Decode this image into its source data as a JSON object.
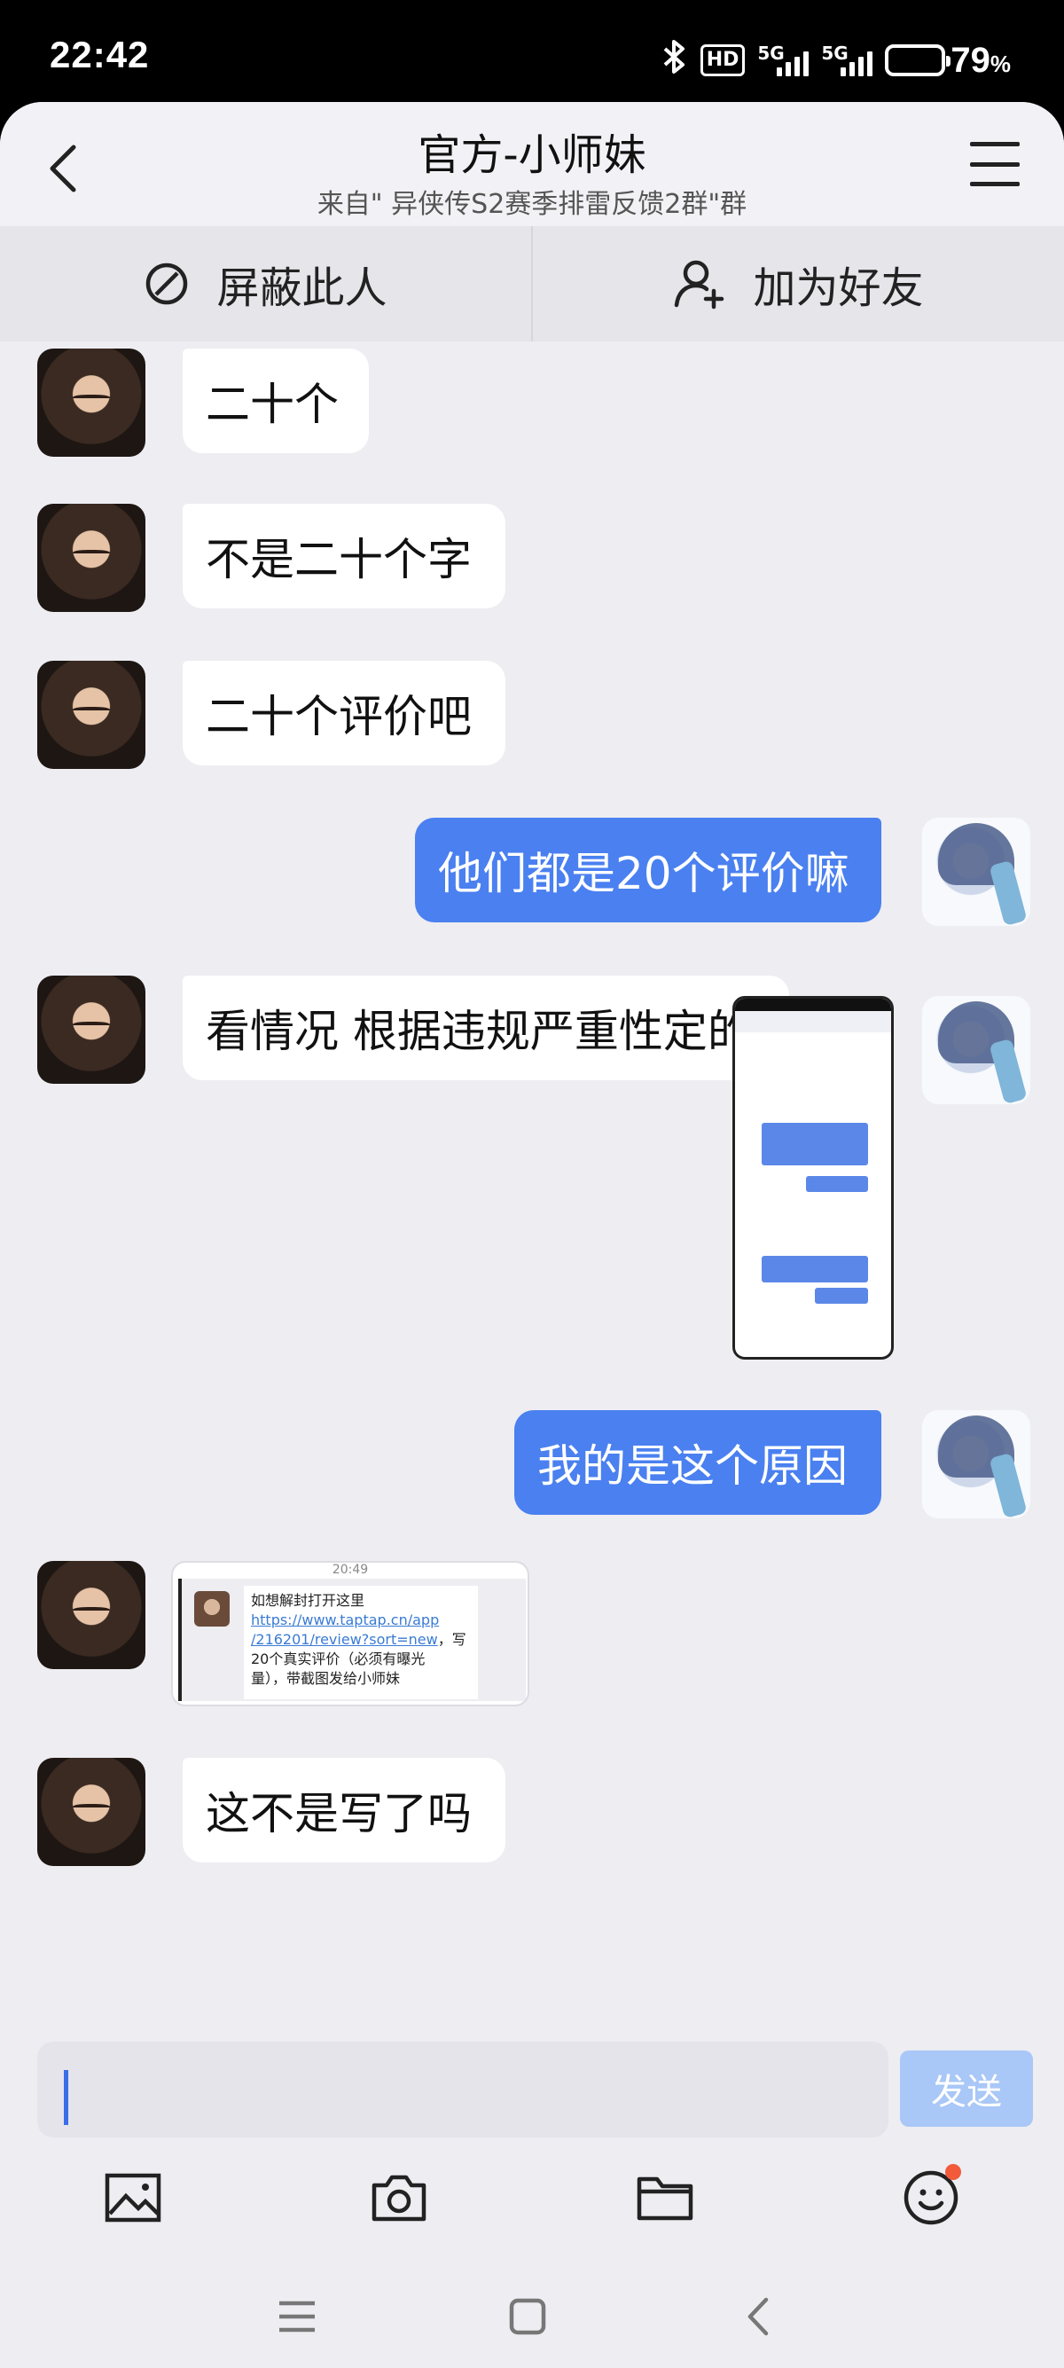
{
  "status_bar": {
    "time": "22:42",
    "bluetooth_icon": "bluetooth-icon",
    "hd_badge": "HD",
    "network1": "5G",
    "network2": "5G",
    "battery_pct": "79",
    "battery_unit": "%",
    "battery_level": 0.79
  },
  "header": {
    "title": "官方-小师妹",
    "subtitle": "来自\" 异侠传S2赛季排雷反馈2群\"群",
    "back_icon": "back-arrow-icon",
    "menu_icon": "menu-icon"
  },
  "actions": {
    "block_label": "屏蔽此人",
    "add_friend_label": "加为好友"
  },
  "messages": [
    {
      "side": "left",
      "type": "text",
      "text": "二十个"
    },
    {
      "side": "left",
      "type": "text",
      "text": "不是二十个字"
    },
    {
      "side": "left",
      "type": "text",
      "text": "二十个评价吧"
    },
    {
      "side": "right",
      "type": "text",
      "text": "他们都是20个评价嘛"
    },
    {
      "side": "left",
      "type": "text",
      "text": "看情况 根据违规严重性定的"
    },
    {
      "side": "right",
      "type": "image",
      "text": ""
    },
    {
      "side": "right",
      "type": "text",
      "text": "我的是这个原因"
    },
    {
      "side": "left",
      "type": "card",
      "text": ""
    },
    {
      "side": "left",
      "type": "text",
      "text": "这不是写了吗"
    }
  ],
  "card": {
    "timestamp": "20:49",
    "line1": "如想解封打开这里",
    "link": "https://www.taptap.cn/app/216201/review?sort=new",
    "link_a": "https://www.taptap.cn/app",
    "link_b": "/216201/review?sort=new",
    "after_link": "，写",
    "line3": "20个真实评价（必须有曝光",
    "line4": "量），带截图发给小师妹"
  },
  "input": {
    "placeholder": "",
    "value": "",
    "send_label": "发送"
  },
  "toolbar": {
    "items": [
      "image-icon",
      "camera-icon",
      "folder-icon",
      "emoji-icon"
    ],
    "emoji_has_badge": true
  },
  "navbar": {
    "items": [
      "recent-apps-icon",
      "home-icon",
      "back-icon"
    ]
  }
}
